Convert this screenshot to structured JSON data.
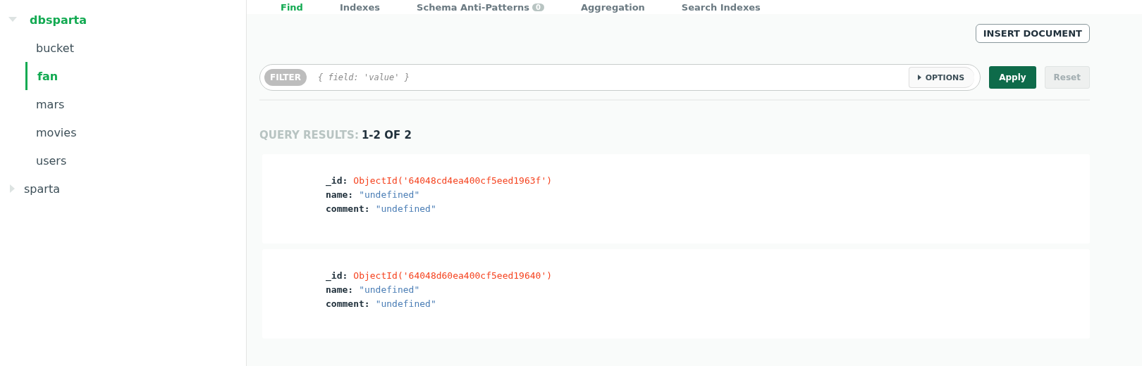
{
  "sidebar": {
    "databases": [
      {
        "name": "dbsparta",
        "expanded": true,
        "children": [
          {
            "name": "bucket",
            "selected": false
          },
          {
            "name": "fan",
            "selected": true
          },
          {
            "name": "mars",
            "selected": false
          },
          {
            "name": "movies",
            "selected": false
          },
          {
            "name": "users",
            "selected": false
          }
        ]
      },
      {
        "name": "sparta",
        "expanded": false
      }
    ]
  },
  "tabs": [
    {
      "label": "Find",
      "selected": true
    },
    {
      "label": "Indexes",
      "selected": false
    },
    {
      "label": "Schema Anti-Patterns",
      "selected": false,
      "badge": "0"
    },
    {
      "label": "Aggregation",
      "selected": false
    },
    {
      "label": "Search Indexes",
      "selected": false
    }
  ],
  "insert_button": "INSERT DOCUMENT",
  "filter": {
    "label": "FILTER",
    "placeholder": "{ field: 'value' }",
    "options": "OPTIONS",
    "apply": "Apply",
    "reset": "Reset",
    "reset_disabled": true
  },
  "results": {
    "label": "QUERY RESULTS:",
    "count": "1-2 OF 2"
  },
  "documents": [
    {
      "fields": [
        {
          "key": "_id:",
          "value": "ObjectId('64048cd4ea400cf5eed1963f')",
          "kind": "objectid"
        },
        {
          "key": "name:",
          "value": "\"undefined\"",
          "kind": "string"
        },
        {
          "key": "comment:",
          "value": "\"undefined\"",
          "kind": "string"
        }
      ]
    },
    {
      "fields": [
        {
          "key": "_id:",
          "value": "ObjectId('64048d60ea400cf5eed19640')",
          "kind": "objectid"
        },
        {
          "key": "name:",
          "value": "\"undefined\"",
          "kind": "string"
        },
        {
          "key": "comment:",
          "value": "\"undefined\"",
          "kind": "string"
        }
      ]
    }
  ]
}
